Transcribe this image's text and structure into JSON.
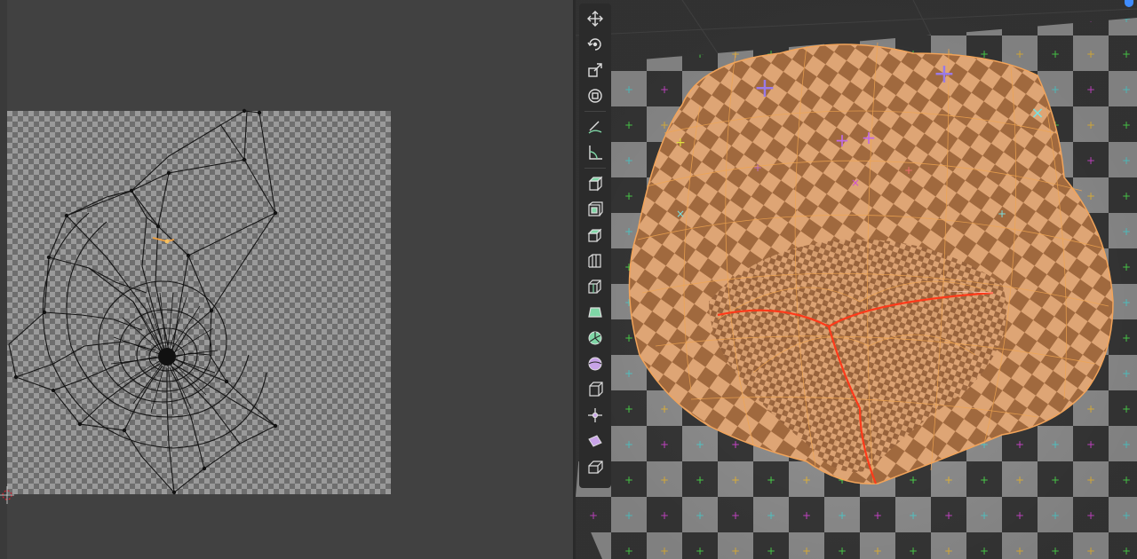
{
  "app": {
    "editors": [
      "uv-editor",
      "3d-viewport"
    ]
  },
  "toolbar": {
    "tools": [
      {
        "name": "move-icon"
      },
      {
        "name": "rotate-icon"
      },
      {
        "name": "scale-icon"
      },
      {
        "name": "transform-icon"
      },
      {
        "name": "annotate-icon"
      },
      {
        "name": "measure-icon"
      },
      {
        "name": "add-cube-icon"
      },
      {
        "name": "extrude-region-icon"
      },
      {
        "name": "inset-faces-icon"
      },
      {
        "name": "bevel-icon"
      },
      {
        "name": "loop-cut-icon"
      },
      {
        "name": "knife-icon"
      },
      {
        "name": "poly-build-icon"
      },
      {
        "name": "spin-icon"
      },
      {
        "name": "smooth-icon"
      },
      {
        "name": "edge-slide-icon"
      },
      {
        "name": "shrink-fatten-icon"
      },
      {
        "name": "shear-icon"
      },
      {
        "name": "rip-region-icon"
      }
    ]
  },
  "colors": {
    "uv_background": "#414141",
    "viewport_background": "#3a3a3a",
    "mesh_selected": "#e8a060",
    "seam": "#ff3a1a",
    "toolbar": "#2b2b2b",
    "active_tool_accent": "#7fd6a6",
    "navigation_accent": "#3f8cff"
  }
}
